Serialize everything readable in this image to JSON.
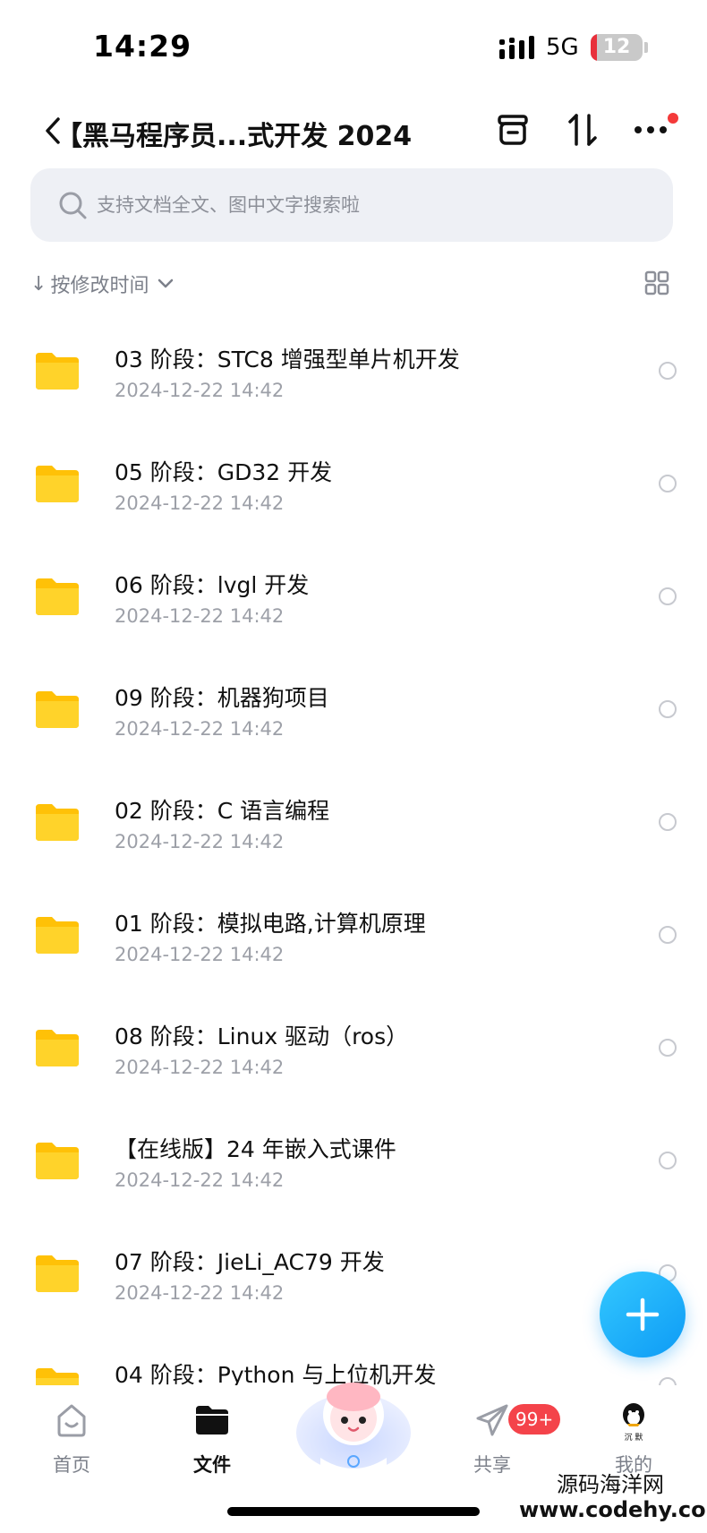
{
  "status_bar": {
    "time": "14:29",
    "network": "5G",
    "battery": "12",
    "battery_level": 0.12
  },
  "header": {
    "title": "【黑马程序员...式开发 2024"
  },
  "search": {
    "placeholder": "支持文档全文、图中文字搜索啦"
  },
  "sort": {
    "arrow": "↓",
    "label": "按修改时间"
  },
  "files": [
    {
      "name": "03 阶段：STC8 增强型单片机开发",
      "date": "2024-12-22 14:42"
    },
    {
      "name": "05 阶段：GD32 开发",
      "date": "2024-12-22 14:42"
    },
    {
      "name": "06 阶段：lvgl 开发",
      "date": "2024-12-22 14:42"
    },
    {
      "name": "09 阶段：机器狗项目",
      "date": "2024-12-22 14:42"
    },
    {
      "name": "02 阶段：C 语言编程",
      "date": "2024-12-22 14:42"
    },
    {
      "name": "01 阶段：模拟电路,计算机原理",
      "date": "2024-12-22 14:42"
    },
    {
      "name": "08 阶段：Linux 驱动（ros）",
      "date": "2024-12-22 14:42"
    },
    {
      "name": "【在线版】24 年嵌入式课件",
      "date": "2024-12-22 14:42"
    },
    {
      "name": "07 阶段：JieLi_AC79 开发",
      "date": "2024-12-22 14:42"
    },
    {
      "name": "04 阶段：Python 与上位机开发",
      "date": ""
    }
  ],
  "bottom_nav": {
    "home": "首页",
    "files": "文件",
    "share": "共享",
    "share_badge": "99+",
    "mine": "我的",
    "mine_avatar_text": "沉 默"
  },
  "watermark": {
    "line1": "源码海洋网",
    "line2": "www.codehy.com"
  },
  "colors": {
    "accent": "#0e9bf5",
    "folder": "#ffc107",
    "badge": "#f4434a",
    "notify_dot": "#f43a3a"
  }
}
